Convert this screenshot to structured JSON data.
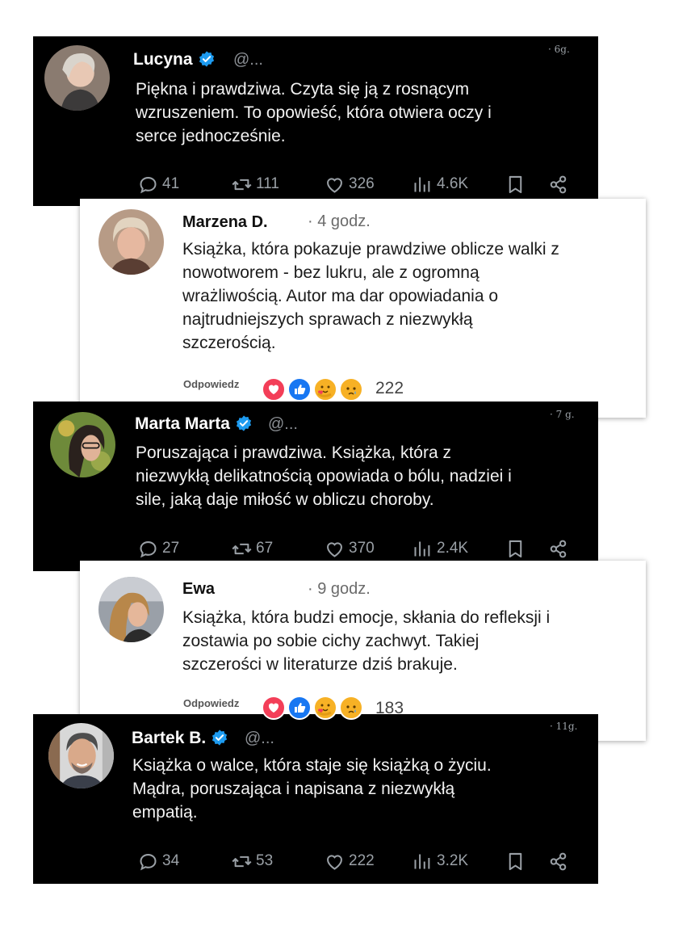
{
  "posts": [
    {
      "name": "Lucyna",
      "handle": "@...",
      "time": "· 6g.",
      "text": "Piękna i prawdziwa. Czyta się ją z rosnącym\nwzruszeniem. To opowieść, która otwiera oczy i\nserce jednocześnie.",
      "replies": "41",
      "reposts": "111",
      "likes": "326",
      "views": "4.6K"
    },
    {
      "name": "Marzena D.",
      "time": "· 4 godz.",
      "text": "Książka, która pokazuje prawdziwe oblicze walki z\nnowotworem - bez lukru, ale z ogromną\nwrażliwością. Autor ma dar opowiadania o\nnajtrudniejszych sprawach z niezwykłą\nszczerością.",
      "reply_label": "Odpowiedz",
      "reactions": "222"
    },
    {
      "name": "Marta Marta",
      "handle": "@...",
      "time": "· 7 g.",
      "text": "Poruszająca i prawdziwa. Książka, która z\nniezwykłą delikatnością opowiada o bólu, nadziei i\nsile, jaką daje miłość w obliczu choroby.",
      "replies": "27",
      "reposts": "67",
      "likes": "370",
      "views": "2.4K"
    },
    {
      "name": "Ewa",
      "time": "· 9 godz.",
      "text": "Książka, która budzi emocje, skłania do refleksji i\nzostawia po sobie cichy zachwyt. Takiej\nszczerości w literaturze dziś brakuje.",
      "reply_label": "Odpowiedz",
      "reactions": "183"
    },
    {
      "name": "Bartek B.",
      "handle": "@...",
      "time": "· 11g.",
      "text": "Książka o walce, która staje się książką o życiu.\nMądra, poruszająca i napisana z niezwykłą\nempatią.",
      "replies": "34",
      "reposts": "53",
      "likes": "222",
      "views": "3.2K"
    }
  ],
  "colors": {
    "verified": "#1d9bf0",
    "dark_card": "#000000",
    "light_card": "#ffffff",
    "muted": "#9aa0a6"
  },
  "icons": [
    "verified-badge-icon",
    "reply-icon",
    "repost-icon",
    "like-icon",
    "views-icon",
    "bookmark-icon",
    "share-icon",
    "love-reaction-icon",
    "like-reaction-icon",
    "care-reaction-icon",
    "sad-reaction-icon"
  ]
}
